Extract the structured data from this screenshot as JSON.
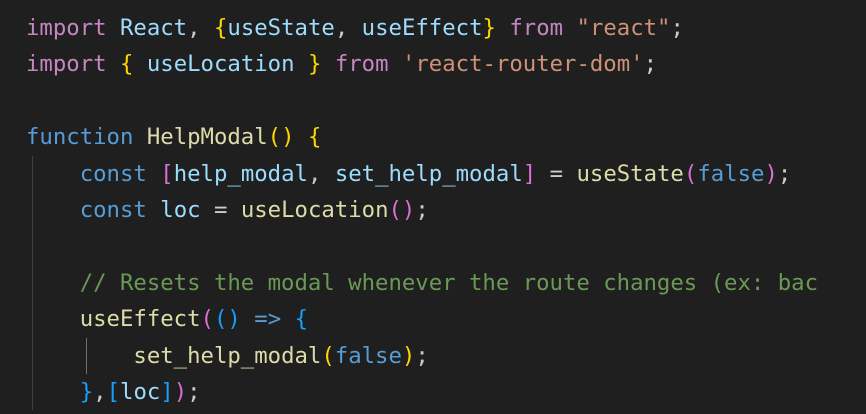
{
  "editor": {
    "lines": [
      {
        "tokens": [
          {
            "t": "import",
            "c": "kw-import"
          },
          {
            "t": " ",
            "c": "punc"
          },
          {
            "t": "React",
            "c": "var"
          },
          {
            "t": ", ",
            "c": "punc"
          },
          {
            "t": "{",
            "c": "br1"
          },
          {
            "t": "useState",
            "c": "var"
          },
          {
            "t": ", ",
            "c": "punc"
          },
          {
            "t": "useEffect",
            "c": "var"
          },
          {
            "t": "}",
            "c": "br1"
          },
          {
            "t": " ",
            "c": "punc"
          },
          {
            "t": "from",
            "c": "kw-import"
          },
          {
            "t": " ",
            "c": "punc"
          },
          {
            "t": "\"react\"",
            "c": "str"
          },
          {
            "t": ";",
            "c": "punc"
          }
        ]
      },
      {
        "tokens": [
          {
            "t": "import",
            "c": "kw-import"
          },
          {
            "t": " ",
            "c": "punc"
          },
          {
            "t": "{",
            "c": "br1"
          },
          {
            "t": " useLocation ",
            "c": "var"
          },
          {
            "t": "}",
            "c": "br1"
          },
          {
            "t": " ",
            "c": "punc"
          },
          {
            "t": "from",
            "c": "kw-import"
          },
          {
            "t": " ",
            "c": "punc"
          },
          {
            "t": "'react-router-dom'",
            "c": "str"
          },
          {
            "t": ";",
            "c": "punc"
          }
        ]
      },
      {
        "tokens": []
      },
      {
        "tokens": [
          {
            "t": "function",
            "c": "kw-decl"
          },
          {
            "t": " ",
            "c": "punc"
          },
          {
            "t": "HelpModal",
            "c": "fn"
          },
          {
            "t": "()",
            "c": "br1"
          },
          {
            "t": " ",
            "c": "punc"
          },
          {
            "t": "{",
            "c": "br1"
          }
        ]
      },
      {
        "guides": [
          1
        ],
        "tokens": [
          {
            "t": "    ",
            "c": "punc"
          },
          {
            "t": "const",
            "c": "kw-decl"
          },
          {
            "t": " ",
            "c": "punc"
          },
          {
            "t": "[",
            "c": "br2"
          },
          {
            "t": "help_modal",
            "c": "var"
          },
          {
            "t": ", ",
            "c": "punc"
          },
          {
            "t": "set_help_modal",
            "c": "var"
          },
          {
            "t": "]",
            "c": "br2"
          },
          {
            "t": " = ",
            "c": "punc"
          },
          {
            "t": "useState",
            "c": "fn"
          },
          {
            "t": "(",
            "c": "br2"
          },
          {
            "t": "false",
            "c": "kw-decl"
          },
          {
            "t": ")",
            "c": "br2"
          },
          {
            "t": ";",
            "c": "punc"
          }
        ]
      },
      {
        "guides": [
          1
        ],
        "tokens": [
          {
            "t": "    ",
            "c": "punc"
          },
          {
            "t": "const",
            "c": "kw-decl"
          },
          {
            "t": " ",
            "c": "punc"
          },
          {
            "t": "loc",
            "c": "var"
          },
          {
            "t": " = ",
            "c": "punc"
          },
          {
            "t": "useLocation",
            "c": "fn"
          },
          {
            "t": "()",
            "c": "br2"
          },
          {
            "t": ";",
            "c": "punc"
          }
        ]
      },
      {
        "guides": [
          1
        ],
        "tokens": []
      },
      {
        "guides": [
          1
        ],
        "tokens": [
          {
            "t": "    ",
            "c": "punc"
          },
          {
            "t": "// Resets the modal whenever the route changes (ex: bac",
            "c": "cmt"
          }
        ]
      },
      {
        "guides": [
          1
        ],
        "tokens": [
          {
            "t": "    ",
            "c": "punc"
          },
          {
            "t": "useEffect",
            "c": "fn"
          },
          {
            "t": "(",
            "c": "br2"
          },
          {
            "t": "()",
            "c": "br3"
          },
          {
            "t": " ",
            "c": "punc"
          },
          {
            "t": "=>",
            "c": "kw-decl"
          },
          {
            "t": " ",
            "c": "punc"
          },
          {
            "t": "{",
            "c": "br3"
          }
        ]
      },
      {
        "guides": [
          1,
          2
        ],
        "tokens": [
          {
            "t": "        ",
            "c": "punc"
          },
          {
            "t": "set_help_modal",
            "c": "fn"
          },
          {
            "t": "(",
            "c": "br1"
          },
          {
            "t": "false",
            "c": "kw-decl"
          },
          {
            "t": ")",
            "c": "br1"
          },
          {
            "t": ";",
            "c": "punc"
          }
        ]
      },
      {
        "guides": [
          1
        ],
        "tokens": [
          {
            "t": "    ",
            "c": "punc"
          },
          {
            "t": "}",
            "c": "br3"
          },
          {
            "t": ",",
            "c": "punc"
          },
          {
            "t": "[",
            "c": "br3"
          },
          {
            "t": "loc",
            "c": "var"
          },
          {
            "t": "]",
            "c": "br3"
          },
          {
            "t": ")",
            "c": "br2"
          },
          {
            "t": ";",
            "c": "punc"
          }
        ]
      }
    ]
  }
}
